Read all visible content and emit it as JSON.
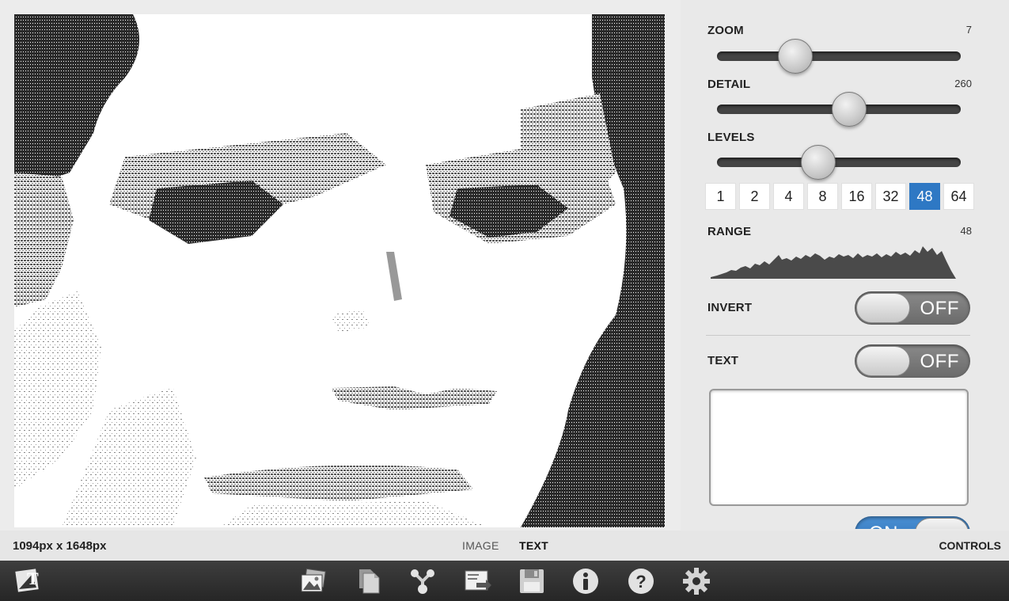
{
  "image_info": {
    "dimensions": "1094px x 1648px"
  },
  "view_tabs": {
    "image": "IMAGE",
    "text": "TEXT"
  },
  "controls_tab": "CONTROLS",
  "controls": {
    "zoom": {
      "label": "ZOOM",
      "value": "7",
      "level": 0.29
    },
    "detail": {
      "label": "DETAIL",
      "value": "260",
      "level": 0.55
    },
    "levels": {
      "label": "LEVELS",
      "level": 0.4
    },
    "level_options": [
      "1",
      "2",
      "4",
      "8",
      "16",
      "32",
      "48",
      "64"
    ],
    "level_selected": "48",
    "range": {
      "label": "RANGE",
      "value": "48"
    },
    "invert": {
      "label": "INVERT",
      "state": "OFF"
    },
    "text": {
      "label": "TEXT",
      "state": "OFF",
      "content": ""
    },
    "repeat": {
      "state": "ON"
    }
  },
  "toolbar": {
    "icons": [
      "app-logo-icon",
      "gallery-icon",
      "documents-icon",
      "share-icon",
      "export-icon",
      "save-icon",
      "info-icon",
      "help-icon",
      "settings-icon"
    ]
  },
  "colors": {
    "accent": "#2e78c4",
    "toolbar_bg": "#2f2f2f",
    "canvas_bg": "#ffffff"
  }
}
